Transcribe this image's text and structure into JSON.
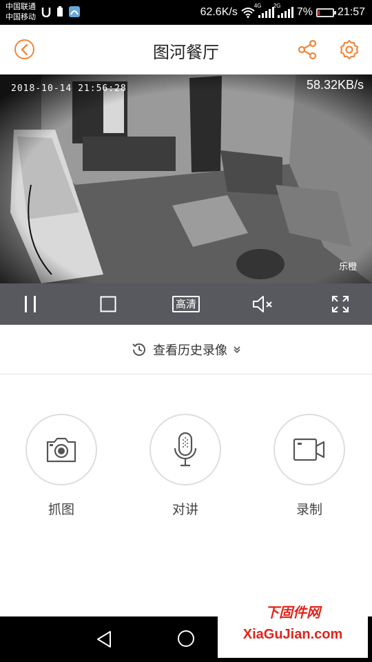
{
  "status_bar": {
    "carrier_1": "中国联通",
    "carrier_2": "中国移动",
    "net_speed": "62.6K/s",
    "signal_1_tag": "4G",
    "signal_2_tag": "2G",
    "battery_percent": "7%",
    "battery_level": 0.07,
    "time": "21:57"
  },
  "header": {
    "title": "图河餐厅",
    "back_icon": "chevron-left-icon",
    "share_icon": "share-icon",
    "settings_icon": "gear-icon"
  },
  "video": {
    "timestamp": "2018-10-14 21:56:28",
    "bitrate": "58.32KB/s",
    "watermark": "乐橙"
  },
  "controls": {
    "pause_icon": "pause-icon",
    "stop_icon": "stop-icon",
    "hd_label": "高清",
    "mute_icon": "mute-icon",
    "fullscreen_icon": "fullscreen-icon"
  },
  "history": {
    "label": "查看历史录像"
  },
  "actions": [
    {
      "label": "抓图",
      "icon": "camera-icon"
    },
    {
      "label": "对讲",
      "icon": "microphone-icon"
    },
    {
      "label": "录制",
      "icon": "video-camera-icon"
    }
  ],
  "site_watermark": {
    "title": "下固件网",
    "url": "XiaGuJian.com"
  },
  "colors": {
    "accent": "#f0873a",
    "control_bar": "#58595e",
    "watermark_red": "#e0241b"
  }
}
